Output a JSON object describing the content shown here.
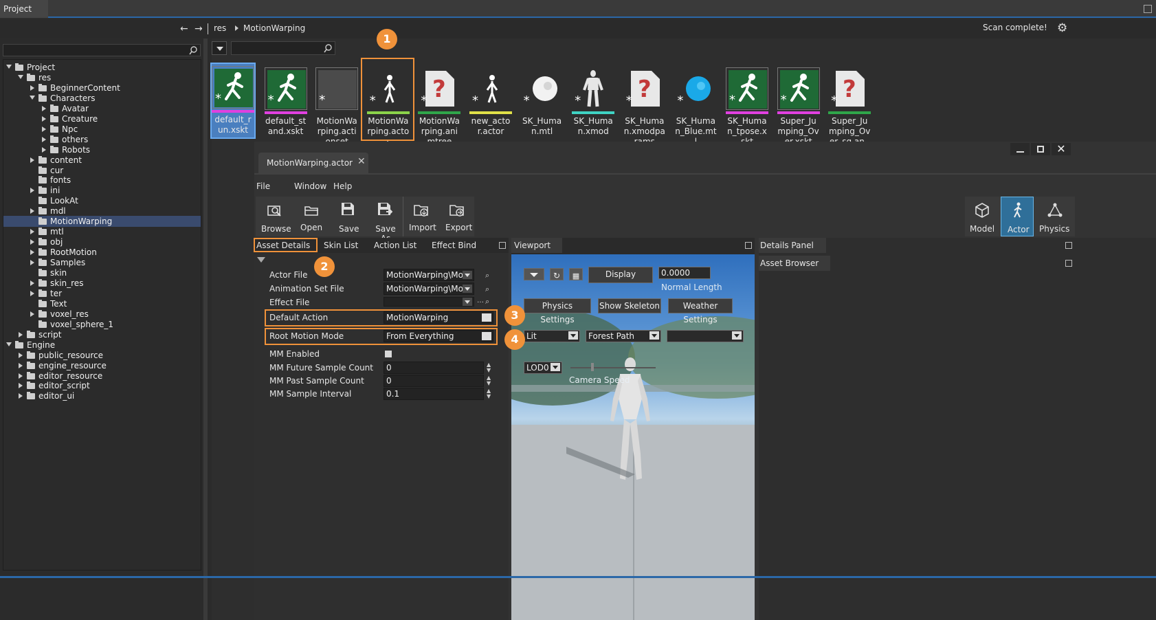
{
  "topbar": {
    "tab": "Project"
  },
  "nav": {
    "breadcrumb_root": "res",
    "breadcrumb_current": "MotionWarping",
    "status": "Scan complete!"
  },
  "tree": [
    {
      "label": "Project",
      "depth": 0,
      "state": "open",
      "sel": false
    },
    {
      "label": "res",
      "depth": 1,
      "state": "open",
      "sel": false
    },
    {
      "label": "BeginnerContent",
      "depth": 2,
      "state": "closed",
      "sel": false
    },
    {
      "label": "Characters",
      "depth": 2,
      "state": "open",
      "sel": false
    },
    {
      "label": "Avatar",
      "depth": 3,
      "state": "closed",
      "sel": false
    },
    {
      "label": "Creature",
      "depth": 3,
      "state": "closed",
      "sel": false
    },
    {
      "label": "Npc",
      "depth": 3,
      "state": "closed",
      "sel": false
    },
    {
      "label": "others",
      "depth": 3,
      "state": "closed",
      "sel": false
    },
    {
      "label": "Robots",
      "depth": 3,
      "state": "closed",
      "sel": false
    },
    {
      "label": "content",
      "depth": 2,
      "state": "closed",
      "sel": false
    },
    {
      "label": "cur",
      "depth": 2,
      "state": "none",
      "sel": false
    },
    {
      "label": "fonts",
      "depth": 2,
      "state": "none",
      "sel": false
    },
    {
      "label": "ini",
      "depth": 2,
      "state": "closed",
      "sel": false
    },
    {
      "label": "LookAt",
      "depth": 2,
      "state": "none",
      "sel": false
    },
    {
      "label": "mdl",
      "depth": 2,
      "state": "closed",
      "sel": false
    },
    {
      "label": "MotionWarping",
      "depth": 2,
      "state": "none",
      "sel": true
    },
    {
      "label": "mtl",
      "depth": 2,
      "state": "closed",
      "sel": false
    },
    {
      "label": "obj",
      "depth": 2,
      "state": "closed",
      "sel": false
    },
    {
      "label": "RootMotion",
      "depth": 2,
      "state": "closed",
      "sel": false
    },
    {
      "label": "Samples",
      "depth": 2,
      "state": "closed",
      "sel": false
    },
    {
      "label": "skin",
      "depth": 2,
      "state": "none",
      "sel": false
    },
    {
      "label": "skin_res",
      "depth": 2,
      "state": "closed",
      "sel": false
    },
    {
      "label": "ter",
      "depth": 2,
      "state": "closed",
      "sel": false
    },
    {
      "label": "Text",
      "depth": 2,
      "state": "none",
      "sel": false
    },
    {
      "label": "voxel_res",
      "depth": 2,
      "state": "closed",
      "sel": false
    },
    {
      "label": "voxel_sphere_1",
      "depth": 2,
      "state": "none",
      "sel": false
    },
    {
      "label": "script",
      "depth": 1,
      "state": "closed",
      "sel": false
    },
    {
      "label": "Engine",
      "depth": 0,
      "state": "open",
      "sel": false
    },
    {
      "label": "public_resource",
      "depth": 1,
      "state": "closed",
      "sel": false
    },
    {
      "label": "engine_resource",
      "depth": 1,
      "state": "closed",
      "sel": false
    },
    {
      "label": "editor_resource",
      "depth": 1,
      "state": "closed",
      "sel": false
    },
    {
      "label": "editor_script",
      "depth": 1,
      "state": "closed",
      "sel": false
    },
    {
      "label": "editor_ui",
      "depth": 1,
      "state": "closed",
      "sel": false
    }
  ],
  "assets": [
    {
      "lines": [
        "default_r",
        "un.xskt"
      ],
      "kind": "run",
      "bar": "#e040e0",
      "selected": true
    },
    {
      "lines": [
        "default_st",
        "and.xskt"
      ],
      "kind": "run",
      "bar": "#e040e0",
      "selected": false
    },
    {
      "lines": [
        "MotionWa",
        "rping.acti",
        "onset"
      ],
      "kind": "blank",
      "bar": "",
      "selected": false
    },
    {
      "lines": [
        "MotionWa",
        "rping.acto",
        "r"
      ],
      "kind": "actor",
      "bar": "#8bd34a",
      "selected": false
    },
    {
      "lines": [
        "MotionWa",
        "rping.ani",
        "mtree"
      ],
      "kind": "unknown",
      "bar": "#2fa64a",
      "selected": false
    },
    {
      "lines": [
        "new_acto",
        "r.actor"
      ],
      "kind": "actor",
      "bar": "#e0e048",
      "selected": false
    },
    {
      "lines": [
        "SK_Huma",
        "n.mtl"
      ],
      "kind": "sphere-white",
      "bar": "",
      "selected": false
    },
    {
      "lines": [
        "SK_Huma",
        "n.xmod"
      ],
      "kind": "human",
      "bar": "#3fd3c3",
      "selected": false
    },
    {
      "lines": [
        "SK_Huma",
        "n.xmodpa",
        "rams"
      ],
      "kind": "unknown-red",
      "bar": "",
      "selected": false
    },
    {
      "lines": [
        "SK_Huma",
        "n_Blue.mt",
        "l"
      ],
      "kind": "sphere-blue",
      "bar": "",
      "selected": false
    },
    {
      "lines": [
        "SK_Huma",
        "n_tpose.x",
        "skt"
      ],
      "kind": "run",
      "bar": "#e040e0",
      "selected": false
    },
    {
      "lines": [
        "Super_Ju",
        "mping_Ov",
        "er.xskt"
      ],
      "kind": "run",
      "bar": "#e040e0",
      "selected": false
    },
    {
      "lines": [
        "Super_Ju",
        "mping_Ov",
        "er_sq.an.."
      ],
      "kind": "unknown",
      "bar": "#2fa64a",
      "selected": false
    }
  ],
  "editor": {
    "tab_title": "MotionWarping.actor",
    "menu": {
      "file": "File",
      "window": "Window",
      "help": "Help"
    },
    "toolbar": {
      "browse": "Browse",
      "open": "Open",
      "save": "Save",
      "save_as": "Save As",
      "import": "Import",
      "export": "Export"
    },
    "modes": {
      "model": "Model",
      "actor": "Actor",
      "physics": "Physics"
    },
    "panel_tabs": {
      "asset_details": "Asset Details",
      "skin_list": "Skin List",
      "action_list": "Action List",
      "effect_bind": "Effect Bind"
    },
    "props": {
      "actor_file_label": "Actor File",
      "actor_file_value": "MotionWarping\\Mot",
      "anim_set_label": "Animation Set File",
      "anim_set_value": "MotionWarping\\Mot",
      "effect_file_label": "Effect File",
      "effect_file_value": "",
      "default_action_label": "Default Action",
      "default_action_value": "MotionWarping",
      "root_motion_label": "Root Motion Mode",
      "root_motion_value": "From Everything",
      "mm_enabled_label": "MM Enabled",
      "mm_future_label": "MM Future Sample Count",
      "mm_future_value": "0",
      "mm_past_label": "MM Past Sample Count",
      "mm_past_value": "0",
      "mm_interval_label": "MM Sample Interval",
      "mm_interval_value": "0.1"
    },
    "viewport": {
      "title": "Viewport",
      "display": "Display",
      "display_value": "0.0000",
      "normal_length": "Normal Length",
      "physics_settings": "Physics Settings",
      "show_skeleton": "Show Skeleton",
      "weather_settings": "Weather Settings",
      "lighting": "Lit",
      "scene": "Forest Path",
      "extra": "",
      "lod": "LOD0",
      "camera_speed": "Camera Speed"
    },
    "details_panel": "Details Panel",
    "asset_browser": "Asset Browser"
  },
  "callouts": {
    "c1": "1",
    "c2": "2",
    "c3": "3",
    "c4": "4"
  },
  "colors": {
    "accent": "#f0923a",
    "selection": "#3a4b6e",
    "active_mode": "#2f6f99"
  }
}
